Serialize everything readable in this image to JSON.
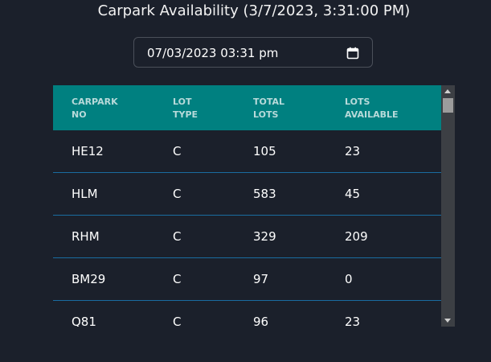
{
  "page": {
    "title": "Carpark Availability (3/7/2023, 3:31:00 PM)"
  },
  "datetime_input": {
    "value": "07/03/2023 03:31 pm",
    "icon": "calendar-icon"
  },
  "table": {
    "headers": [
      [
        "CARPARK",
        "NO"
      ],
      [
        "LOT",
        "TYPE"
      ],
      [
        "TOTAL",
        "LOTS"
      ],
      [
        "LOTS",
        "AVAILABLE"
      ]
    ],
    "rows": [
      [
        "HE12",
        "C",
        "105",
        "23"
      ],
      [
        "HLM",
        "C",
        "583",
        "45"
      ],
      [
        "RHM",
        "C",
        "329",
        "209"
      ],
      [
        "BM29",
        "C",
        "97",
        "0"
      ],
      [
        "Q81",
        "C",
        "96",
        "23"
      ]
    ]
  },
  "colors": {
    "background": "#1b202b",
    "header_background": "#008080",
    "row_divider": "#1a6ca0"
  }
}
